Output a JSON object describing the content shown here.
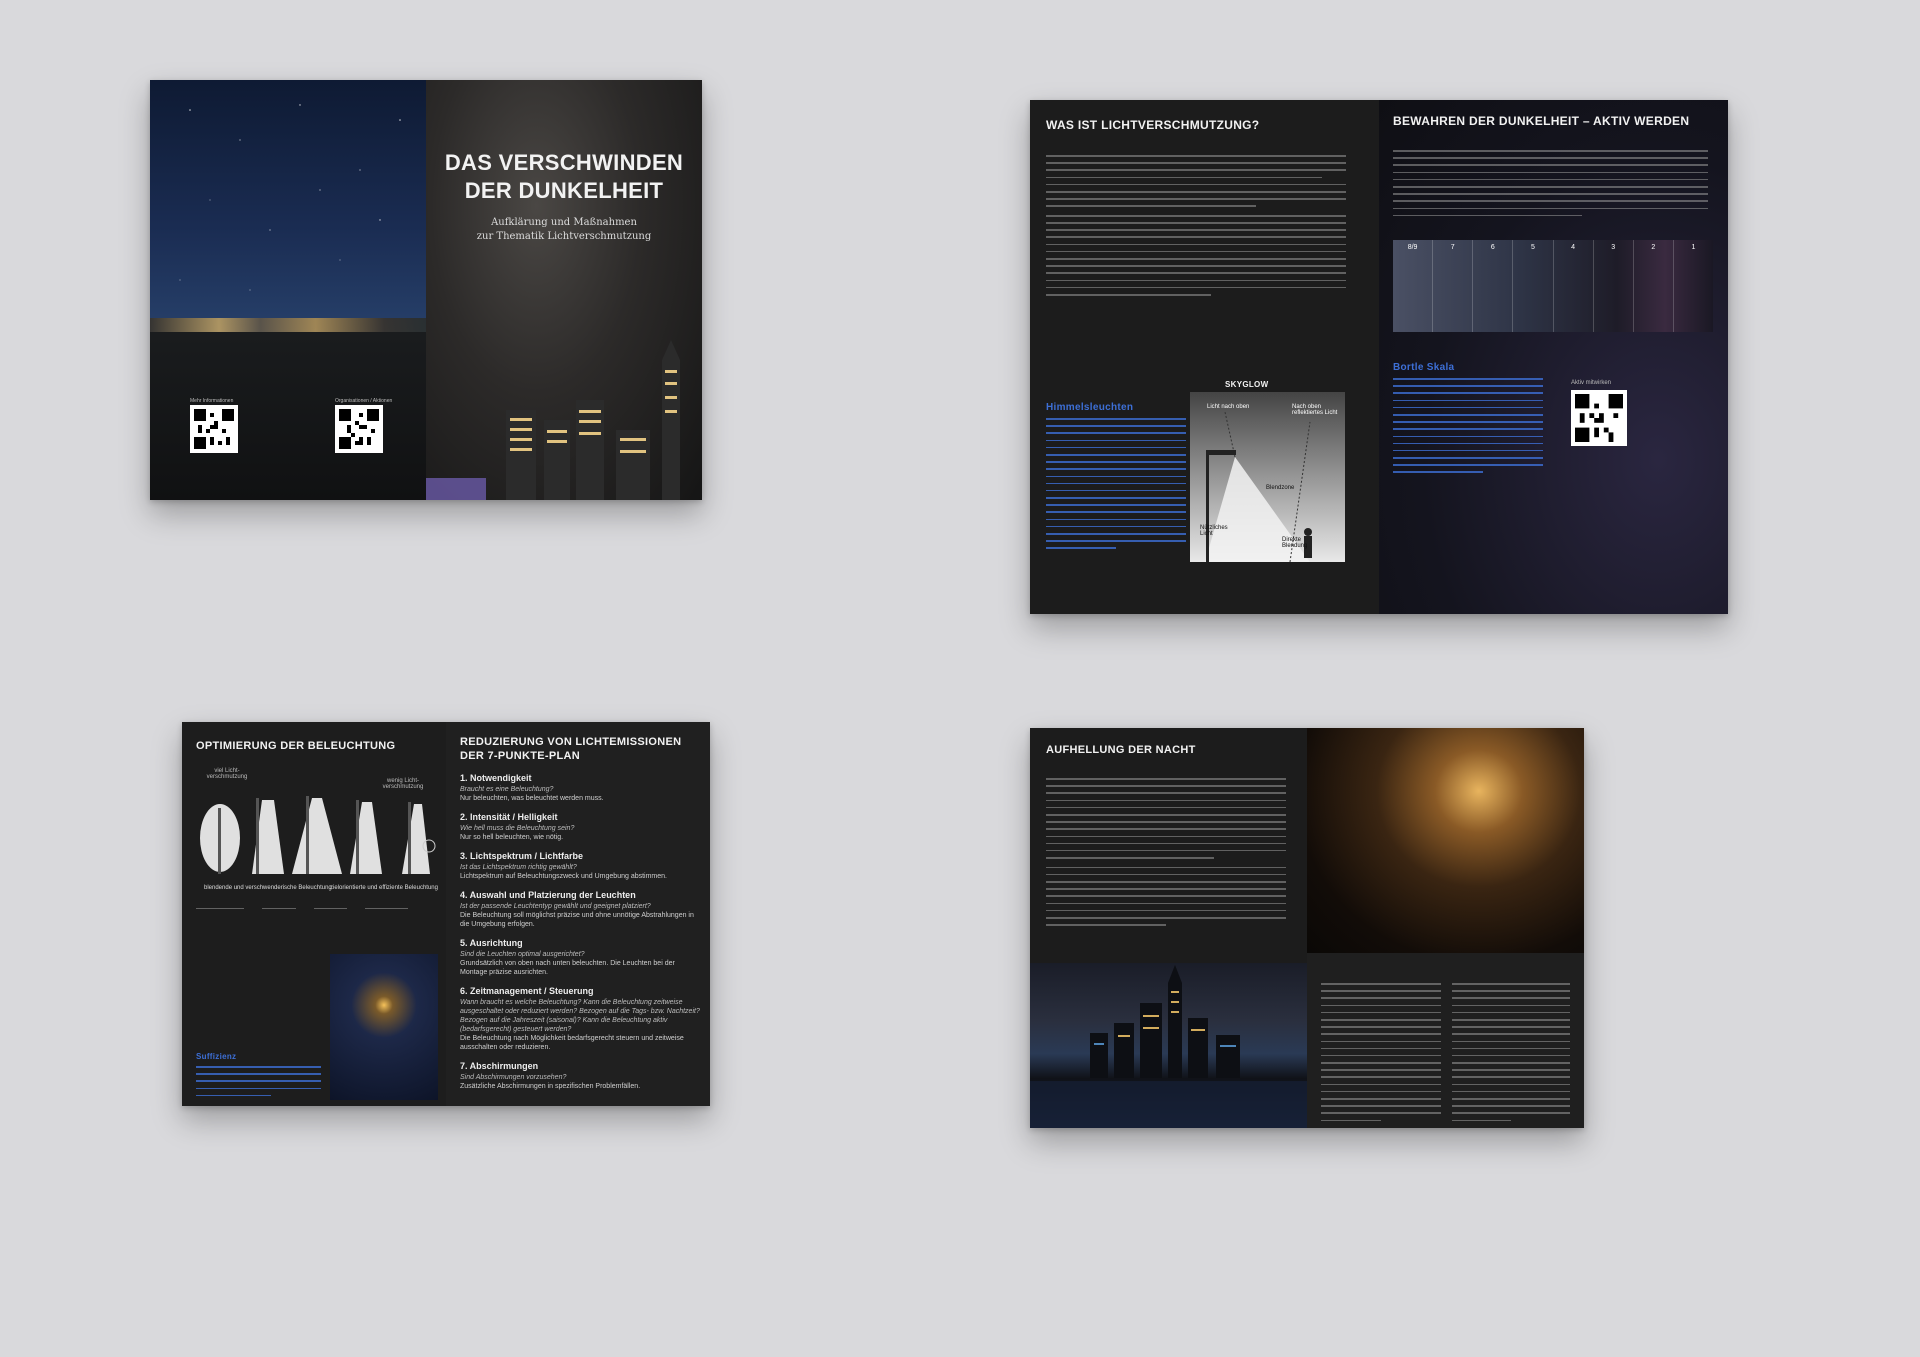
{
  "cover": {
    "title_line1": "DAS VERSCHWINDEN",
    "title_line2": "DER DUNKELHEIT",
    "subtitle_line1": "Aufklärung und Maßnahmen",
    "subtitle_line2": "zur Thematik Lichtverschmutzung",
    "qr_label_left": "Mehr Informationen",
    "qr_label_right": "Organisationen / Aktionen"
  },
  "spread2": {
    "left_heading": "WAS IST LICHTVERSCHMUTZUNG?",
    "himmelsleuchten_heading": "Himmelsleuchten",
    "skyglow_label": "SKYGLOW",
    "skyglow_licht_nach_oben": "Licht nach oben",
    "skyglow_reflektiert": "Nach oben reflektiertes Licht",
    "skyglow_blendzone": "Blendzone",
    "skyglow_nuetzlich": "Nützliches Licht",
    "skyglow_direkt": "Direkte Blendung",
    "right_heading": "BEWAHREN DER DUNKELHEIT – AKTIV WERDEN",
    "bortle_heading": "Bortle Skala",
    "bortle_numbers": [
      "8/9",
      "7",
      "6",
      "5",
      "4",
      "3",
      "2",
      "1"
    ],
    "aktiv_label": "Aktiv mitwirken"
  },
  "spread3": {
    "left_heading": "OPTIMIERUNG DER BELEUCHTUNG",
    "viel_licht": "viel Licht-verschmutzung",
    "wenig_licht": "wenig Licht-verschmutzung",
    "blendende": "blendende und verschwenderische Beleuchtung",
    "zielorientierte": "zielorientierte und effiziente Beleuchtung",
    "suffizienz_heading": "Suffizienz",
    "right_heading_line1": "REDUZIERUNG VON LICHTEMISSIONEN",
    "right_heading_line2": "DER 7-PUNKTE-PLAN",
    "plan": [
      {
        "title": "1. Notwendigkeit",
        "q": "Braucht es eine Beleuchtung?",
        "a": "Nur beleuchten, was beleuchtet werden muss."
      },
      {
        "title": "2. Intensität / Helligkeit",
        "q": "Wie hell muss die Beleuchtung sein?",
        "a": "Nur so hell beleuchten, wie nötig."
      },
      {
        "title": "3. Lichtspektrum / Lichtfarbe",
        "q": "Ist das Lichtspektrum richtig gewählt?",
        "a": "Lichtspektrum auf Beleuchtungszweck und Umgebung abstimmen."
      },
      {
        "title": "4. Auswahl und Platzierung der Leuchten",
        "q": "Ist der passende Leuchtentyp gewählt und geeignet platziert?",
        "a": "Die Beleuchtung soll möglichst präzise und ohne unnötige Abstrahlungen in die Umgebung erfolgen."
      },
      {
        "title": "5. Ausrichtung",
        "q": "Sind die Leuchten optimal ausgerichtet?",
        "a": "Grundsätzlich von oben nach unten beleuchten. Die Leuchten bei der Montage präzise ausrichten."
      },
      {
        "title": "6. Zeitmanagement / Steuerung",
        "q": "Wann braucht es welche Beleuchtung? Kann die Beleuchtung zeitweise ausgeschaltet oder reduziert werden? Bezogen auf die Tags- bzw. Nachtzeit? Bezogen auf die Jahreszeit (saisonal)? Kann die Beleuchtung aktiv (bedarfsgerecht) gesteuert werden?",
        "a": "Die Beleuchtung nach Möglichkeit bedarfsgerecht steuern und zeitweise ausschalten oder reduzieren."
      },
      {
        "title": "7. Abschirmungen",
        "q": "Sind Abschirmungen vorzusehen?",
        "a": "Zusätzliche Abschirmungen in spezifischen Problemfällen."
      }
    ]
  },
  "spread4": {
    "left_heading": "AUFHELLUNG DER NACHT"
  },
  "colors": {
    "background": "#d9d9dc",
    "page": "#1f1f1f",
    "accent_blue": "#3d6fd6"
  }
}
